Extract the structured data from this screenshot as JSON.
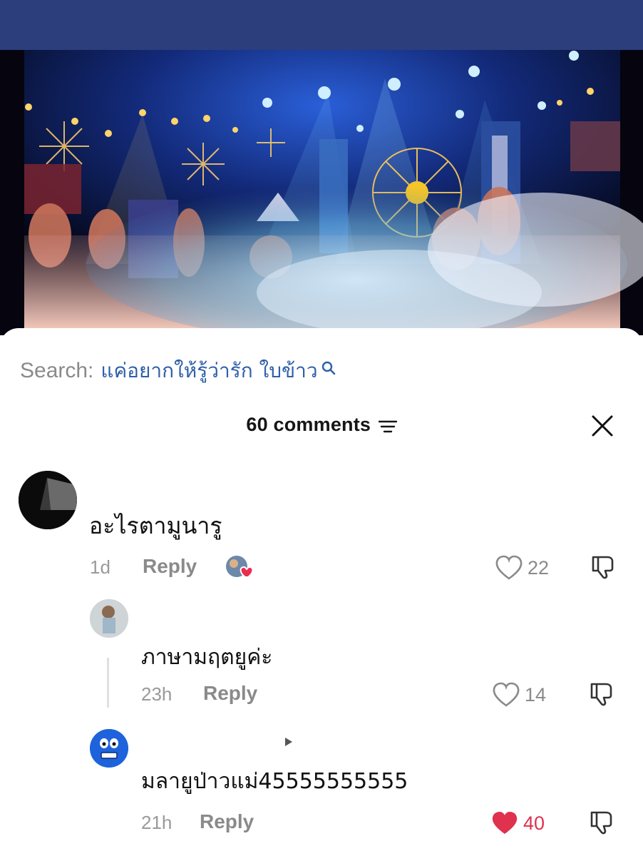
{
  "search": {
    "label": "Search:",
    "query": "แค่อยากให้รู้ว่ารัก ใบข้าว"
  },
  "comments_header": {
    "count_label": "60 comments"
  },
  "comments": [
    {
      "text": "อะไรตามูนารู",
      "time": "1d",
      "reply_label": "Reply",
      "likes": "22",
      "liked": false
    },
    {
      "text": "ภาษามฤตยูค่ะ",
      "time": "23h",
      "reply_label": "Reply",
      "likes": "14",
      "liked": false
    },
    {
      "text": "มลายูป่าวแม่45555555555",
      "time": "21h",
      "reply_label": "Reply",
      "likes": "40",
      "liked": true
    }
  ],
  "colors": {
    "top_bar": "#2c3e7c",
    "search_query": "#2f5fa8",
    "like_active": "#e0314f"
  }
}
